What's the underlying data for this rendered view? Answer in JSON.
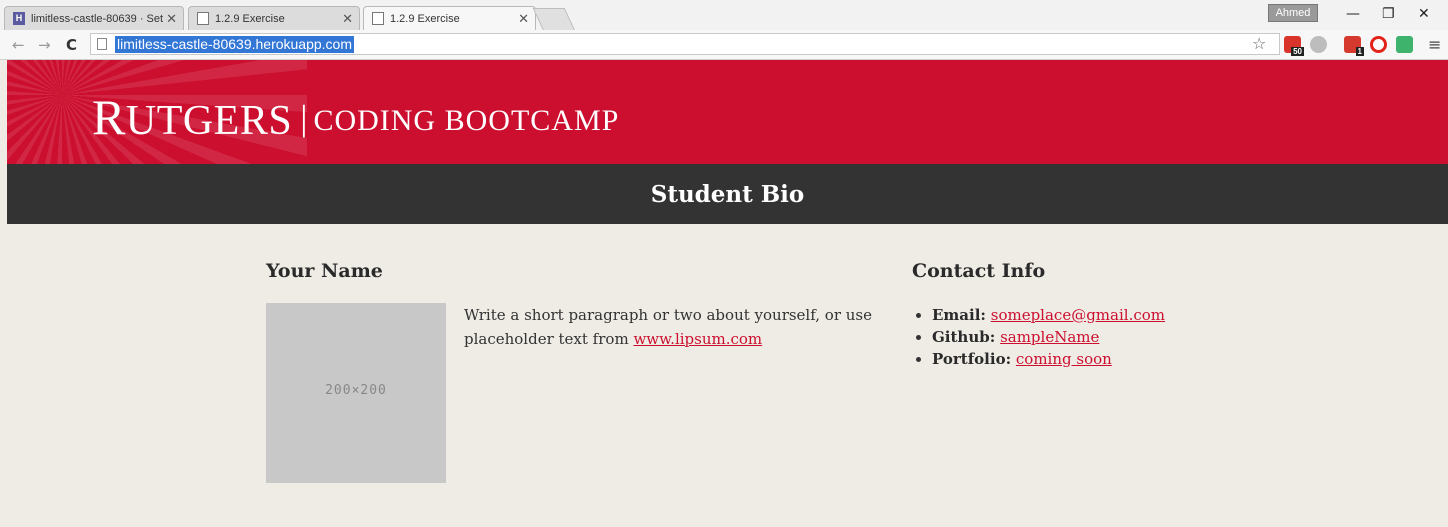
{
  "browser": {
    "tabs": [
      {
        "title": "limitless-castle-80639 · Set",
        "icon": "heroku-icon"
      },
      {
        "title": "1.2.9 Exercise",
        "icon": "page-icon"
      },
      {
        "title": "1.2.9 Exercise",
        "icon": "page-icon"
      }
    ],
    "profile_name": "Ahmed",
    "url": "limitless-castle-80639.herokuapp.com",
    "extensions": [
      {
        "name": "mail-extension-icon",
        "badge": "50"
      },
      {
        "name": "pushbullet-extension-icon",
        "badge": ""
      },
      {
        "name": "todoist-extension-icon",
        "badge": "1"
      },
      {
        "name": "opera-extension-icon",
        "badge": ""
      },
      {
        "name": "green-extension-icon",
        "badge": ""
      }
    ]
  },
  "header": {
    "logo_first_letter": "R",
    "logo_rest": "UTGERS",
    "logo_separator": "|",
    "logo_subtitle": "CODING BOOTCAMP",
    "section_title": "Student Bio"
  },
  "profile": {
    "name": "Your Name",
    "image_placeholder_text": "200×200",
    "bio_text": "Write a short paragraph or two about yourself, or use placeholder text from ",
    "bio_link": "www.lipsum.com"
  },
  "contact": {
    "heading": "Contact Info",
    "items": [
      {
        "label": "Email:",
        "value": "someplace@gmail.com"
      },
      {
        "label": "Github:",
        "value": "sampleName"
      },
      {
        "label": "Portfolio:",
        "value": "coming soon"
      }
    ]
  },
  "colors": {
    "brand_red": "#cc0f2f",
    "dark_bar": "#333333",
    "page_bg": "#efece6"
  }
}
